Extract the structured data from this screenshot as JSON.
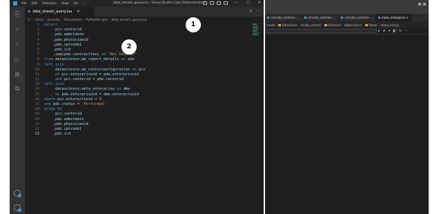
{
  "vscode": {
    "menu": [
      "File",
      "Edit",
      "Selection",
      "View",
      "Go",
      "..."
    ],
    "title": "data_stream_query.lua - Visual Studio Code [Administrator]",
    "window_controls": [
      "—",
      "□",
      "✕"
    ],
    "tab": {
      "icon": "lua-file-icon",
      "label": "data_stream_query.lua",
      "close": "✕"
    },
    "tab_actions": [
      "▯",
      "···"
    ],
    "breadcrumb": [
      "C:",
      "Users",
      "jerrydoc",
      "Documents",
      "PyRootScripts",
      "data_stream_query.lua"
    ],
    "active_line": 23,
    "code": [
      [
        [
          "kw",
          "select"
        ]
      ],
      [
        [
          "pl",
          "     "
        ],
        [
          "id",
          "pcc.centerid"
        ]
      ],
      [
        [
          "pl",
          "    ,"
        ],
        [
          "id",
          "pde.admitdate"
        ]
      ],
      [
        [
          "pl",
          "    ,"
        ],
        [
          "id",
          "pde.physicianid"
        ]
      ],
      [
        [
          "pl",
          "    ,"
        ],
        [
          "id",
          "pde.cptcode1"
        ]
      ],
      [
        [
          "pl",
          "    ,"
        ],
        [
          "id",
          "pde.icd"
        ]
      ],
      [
        [
          "pl",
          "    ,"
        ],
        [
          "fn",
          "sum"
        ],
        [
          "pl",
          "("
        ],
        [
          "id",
          "pde.contractfee"
        ],
        [
          "pl",
          ") "
        ],
        [
          "kw",
          "as"
        ],
        [
          "pl",
          " "
        ],
        [
          "str",
          "\"Net Revenue\""
        ]
      ],
      [
        [
          "kw",
          "from"
        ],
        [
          "pl",
          " "
        ],
        [
          "id",
          "datascience.pm_report_details"
        ],
        [
          "pl",
          " "
        ],
        [
          "kw",
          "as"
        ],
        [
          "pl",
          " "
        ],
        [
          "id",
          "pde"
        ]
      ],
      [
        [
          "kw",
          "left join"
        ]
      ],
      [
        [
          "pl",
          "     "
        ],
        [
          "id",
          "datascience.pm_centerconfiguration"
        ],
        [
          "pl",
          " "
        ],
        [
          "kw",
          "as"
        ],
        [
          "pl",
          " "
        ],
        [
          "id",
          "pcc"
        ]
      ],
      [
        [
          "pl",
          "     "
        ],
        [
          "kw",
          "on"
        ],
        [
          "pl",
          " "
        ],
        [
          "id",
          "pcc.enterpriseid"
        ],
        [
          "pl",
          " = "
        ],
        [
          "id",
          "pde.enterpriseid"
        ]
      ],
      [
        [
          "pl",
          "     "
        ],
        [
          "kw",
          "and"
        ],
        [
          "pl",
          " "
        ],
        [
          "id",
          "pcc.centerid"
        ],
        [
          "pl",
          " = "
        ],
        [
          "id",
          "pde.centerid"
        ]
      ],
      [
        [
          "kw",
          "left join"
        ]
      ],
      [
        [
          "pl",
          "     "
        ],
        [
          "id",
          "datascience.meta_enterprise"
        ],
        [
          "pl",
          " "
        ],
        [
          "kw",
          "as"
        ],
        [
          "pl",
          " "
        ],
        [
          "id",
          "dme"
        ]
      ],
      [
        [
          "pl",
          "     "
        ],
        [
          "kw",
          "on"
        ],
        [
          "pl",
          " "
        ],
        [
          "id",
          "pde.enterpriseid"
        ],
        [
          "pl",
          " = "
        ],
        [
          "id",
          "dme.enterpriseid"
        ]
      ],
      [
        [
          "kw",
          "where"
        ],
        [
          "pl",
          " "
        ],
        [
          "id",
          "pcc.enterpriseid"
        ],
        [
          "pl",
          " = "
        ],
        [
          "num",
          "3"
        ]
      ],
      [
        [
          "kw",
          "and"
        ],
        [
          "pl",
          " "
        ],
        [
          "id",
          "pde.status"
        ],
        [
          "pl",
          " = "
        ],
        [
          "str",
          "'Performed'"
        ]
      ],
      [
        [
          "kw",
          "group by"
        ]
      ],
      [
        [
          "pl",
          "     "
        ],
        [
          "id",
          "pcc.centerid"
        ]
      ],
      [
        [
          "pl",
          "    ,"
        ],
        [
          "id",
          "pde.admitdate"
        ]
      ],
      [
        [
          "pl",
          "    ,"
        ],
        [
          "id",
          "pde.physicianid"
        ]
      ],
      [
        [
          "pl",
          "    ,"
        ],
        [
          "id",
          "pde.cptcode1"
        ]
      ],
      [
        [
          "pl",
          "    ,"
        ],
        [
          "id",
          "pde.icd"
        ]
      ]
    ]
  },
  "markers": [
    "1",
    "2"
  ],
  "right_app": {
    "tabs": [
      {
        "label": "<Inside_central> ...",
        "active": false
      },
      {
        "label": "<Inside_central> ...",
        "active": false
      },
      {
        "label": "<Inside_central> ...",
        "active": false
      },
      {
        "label": "meta_enterprise ✕",
        "active": true
      }
    ],
    "bar_items": [
      "Inside",
      "Databases",
      "Inside_central",
      "Schemas",
      "datascience",
      "Views",
      "meta_enterp"
    ],
    "tool_icons": [
      "▸",
      "≡",
      "▾",
      "◧",
      "↻",
      "⋯"
    ]
  },
  "colors": {
    "editor_bg": "#1e1e1e",
    "activity_bg": "#333333",
    "accent": "#3b9ddd"
  }
}
